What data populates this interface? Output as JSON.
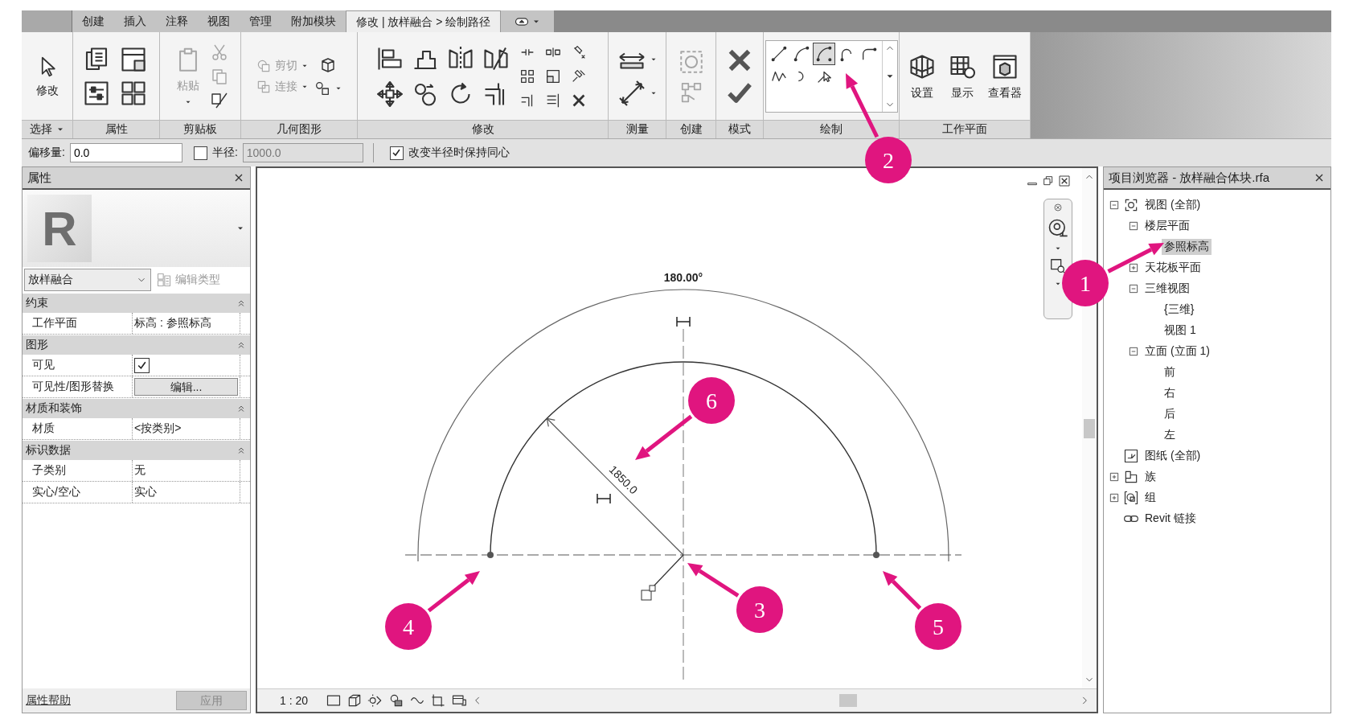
{
  "app_tabs": [
    {
      "label": "创建",
      "selected": false
    },
    {
      "label": "插入",
      "selected": false
    },
    {
      "label": "注释",
      "selected": false
    },
    {
      "label": "视图",
      "selected": false
    },
    {
      "label": "管理",
      "selected": false
    },
    {
      "label": "附加模块",
      "selected": false
    },
    {
      "label": "修改 | 放样融合 > 绘制路径",
      "selected": true
    }
  ],
  "ribbon_panels": [
    {
      "label": "选择",
      "dropdown": true,
      "tools": [
        {
          "label": "修改",
          "disabled": false
        }
      ]
    },
    {
      "label": "属性"
    },
    {
      "label": "剪贴板",
      "tools": [
        {
          "label": "粘贴",
          "disabled": true
        }
      ]
    },
    {
      "label": "几何图形",
      "tools": [
        {
          "label": "剪切",
          "disabled": true
        },
        {
          "label": "连接",
          "disabled": true
        }
      ]
    },
    {
      "label": "修改"
    },
    {
      "label": "测量"
    },
    {
      "label": "创建"
    },
    {
      "label": "模式"
    },
    {
      "label": "绘制",
      "draw_tools": [
        {
          "selected": false
        },
        {
          "selected": false
        },
        {
          "selected": true
        },
        {
          "selected": false
        },
        {
          "selected": false
        },
        {
          "selected": false
        },
        {
          "selected": false
        },
        {
          "selected": false
        }
      ]
    },
    {
      "label": "工作平面",
      "tools": [
        {
          "label": "设置",
          "disabled": false
        },
        {
          "label": "显示",
          "disabled": false
        },
        {
          "label": "查看器",
          "disabled": false
        }
      ]
    }
  ],
  "options_bar": {
    "offset_label": "偏移量:",
    "offset_value": "0.0",
    "radius_checked": false,
    "radius_label": "半径:",
    "radius_value": "1000.0",
    "radius_disabled": true,
    "concentric_checked": true,
    "concentric_label": "改变半径时保持同心"
  },
  "properties": {
    "title": "属性",
    "logo_text": "R",
    "type_name": "放样融合",
    "edit_type_label": "编辑类型",
    "edit_type_disabled": true,
    "groups": [
      {
        "label": "约束",
        "rows": [
          {
            "kind": "text",
            "name": "工作平面",
            "value": "标高 : 参照标高"
          }
        ]
      },
      {
        "label": "图形",
        "rows": [
          {
            "kind": "checkbox",
            "name": "可见",
            "checked": true
          },
          {
            "kind": "button",
            "name": "可见性/图形替换",
            "value": "编辑..."
          }
        ]
      },
      {
        "label": "材质和装饰",
        "rows": [
          {
            "kind": "text",
            "name": "材质",
            "value": "<按类别>"
          }
        ]
      },
      {
        "label": "标识数据",
        "rows": [
          {
            "kind": "text",
            "name": "子类别",
            "value": "无"
          },
          {
            "kind": "text",
            "name": "实心/空心",
            "value": "实心"
          }
        ]
      }
    ],
    "help_link": "属性帮助",
    "apply_label": "应用",
    "apply_disabled": true
  },
  "canvas": {
    "angle_label": "180.00°",
    "radius_label": "1850.0",
    "scale": "1 : 20"
  },
  "project_browser": {
    "title": "项目浏览器 - 放样融合体块.rfa",
    "tree": [
      {
        "label": "视图 (全部)",
        "expanded": true,
        "selected": false,
        "children": [
          {
            "label": "楼层平面",
            "expanded": true,
            "selected": false,
            "children": [
              {
                "label": "参照标高",
                "selected": true
              }
            ]
          },
          {
            "label": "天花板平面",
            "expanded": false,
            "selected": false
          },
          {
            "label": "三维视图",
            "expanded": true,
            "selected": false,
            "children": [
              {
                "label": "{三维}",
                "selected": false
              },
              {
                "label": "视图 1",
                "selected": false
              }
            ]
          },
          {
            "label": "立面 (立面 1)",
            "expanded": true,
            "selected": false,
            "children": [
              {
                "label": "前",
                "selected": false
              },
              {
                "label": "右",
                "selected": false
              },
              {
                "label": "后",
                "selected": false
              },
              {
                "label": "左",
                "selected": false
              }
            ]
          }
        ]
      },
      {
        "label": "图纸 (全部)",
        "selected": false
      },
      {
        "label": "族",
        "expanded": false,
        "selected": false
      },
      {
        "label": "组",
        "expanded": false,
        "selected": false
      },
      {
        "label": "Revit 链接",
        "selected": false
      }
    ]
  },
  "callouts": [
    {
      "label": "1"
    },
    {
      "label": "2"
    },
    {
      "label": "3"
    },
    {
      "label": "4"
    },
    {
      "label": "5"
    },
    {
      "label": "6"
    }
  ]
}
